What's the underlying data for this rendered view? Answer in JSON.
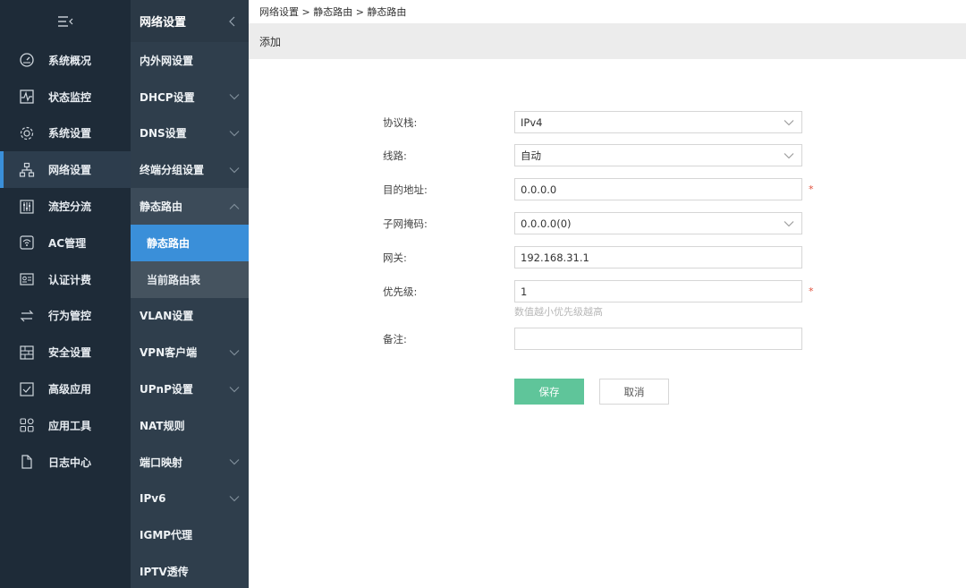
{
  "sidebar": {
    "items": [
      {
        "label": "系统概况",
        "icon": "dashboard-icon"
      },
      {
        "label": "状态监控",
        "icon": "pulse-monitor-icon"
      },
      {
        "label": "系统设置",
        "icon": "gear-icon"
      },
      {
        "label": "网络设置",
        "icon": "network-icon",
        "active": true
      },
      {
        "label": "流控分流",
        "icon": "sliders-icon"
      },
      {
        "label": "AC管理",
        "icon": "wifi-ap-icon"
      },
      {
        "label": "认证计费",
        "icon": "id-card-icon"
      },
      {
        "label": "行为管控",
        "icon": "swap-arrows-icon"
      },
      {
        "label": "安全设置",
        "icon": "firewall-icon"
      },
      {
        "label": "高级应用",
        "icon": "checkbox-icon"
      },
      {
        "label": "应用工具",
        "icon": "apps-icon"
      },
      {
        "label": "日志中心",
        "icon": "document-icon"
      }
    ]
  },
  "subnav": {
    "title": "网络设置",
    "items": [
      {
        "label": "内外网设置"
      },
      {
        "label": "DHCP设置",
        "chevron": "down"
      },
      {
        "label": "DNS设置",
        "chevron": "down"
      },
      {
        "label": "终端分组设置",
        "chevron": "down"
      },
      {
        "label": "静态路由",
        "chevron": "up",
        "expanded": true
      },
      {
        "label": "静态路由",
        "sub": true,
        "active": true
      },
      {
        "label": "当前路由表",
        "sub": true
      },
      {
        "label": "VLAN设置"
      },
      {
        "label": "VPN客户端",
        "chevron": "down"
      },
      {
        "label": "UPnP设置",
        "chevron": "down"
      },
      {
        "label": "NAT规则"
      },
      {
        "label": "端口映射",
        "chevron": "down"
      },
      {
        "label": "IPv6",
        "chevron": "down"
      },
      {
        "label": "IGMP代理"
      },
      {
        "label": "IPTV透传"
      }
    ]
  },
  "breadcrumb": "网络设置 > 静态路由 > 静态路由",
  "page_title": "添加",
  "form": {
    "protocol": {
      "label": "协议栈:",
      "value": "IPv4"
    },
    "line": {
      "label": "线路:",
      "value": "自动"
    },
    "dest": {
      "label": "目的地址:",
      "value": "0.0.0.0",
      "required": "*"
    },
    "mask": {
      "label": "子网掩码:",
      "value": "0.0.0.0(0)"
    },
    "gateway": {
      "label": "网关:",
      "value": "192.168.31.1"
    },
    "priority": {
      "label": "优先级:",
      "value": "1",
      "required": "*",
      "hint": "数值越小优先级越高"
    },
    "note": {
      "label": "备注:",
      "value": ""
    }
  },
  "buttons": {
    "save": "保存",
    "cancel": "取消"
  },
  "colors": {
    "sidebar_bg": "#1e2b38",
    "subnav_bg": "#2f3e4c",
    "accent": "#3a8fd9",
    "save_btn": "#5fc59a",
    "required": "#e0503c"
  }
}
